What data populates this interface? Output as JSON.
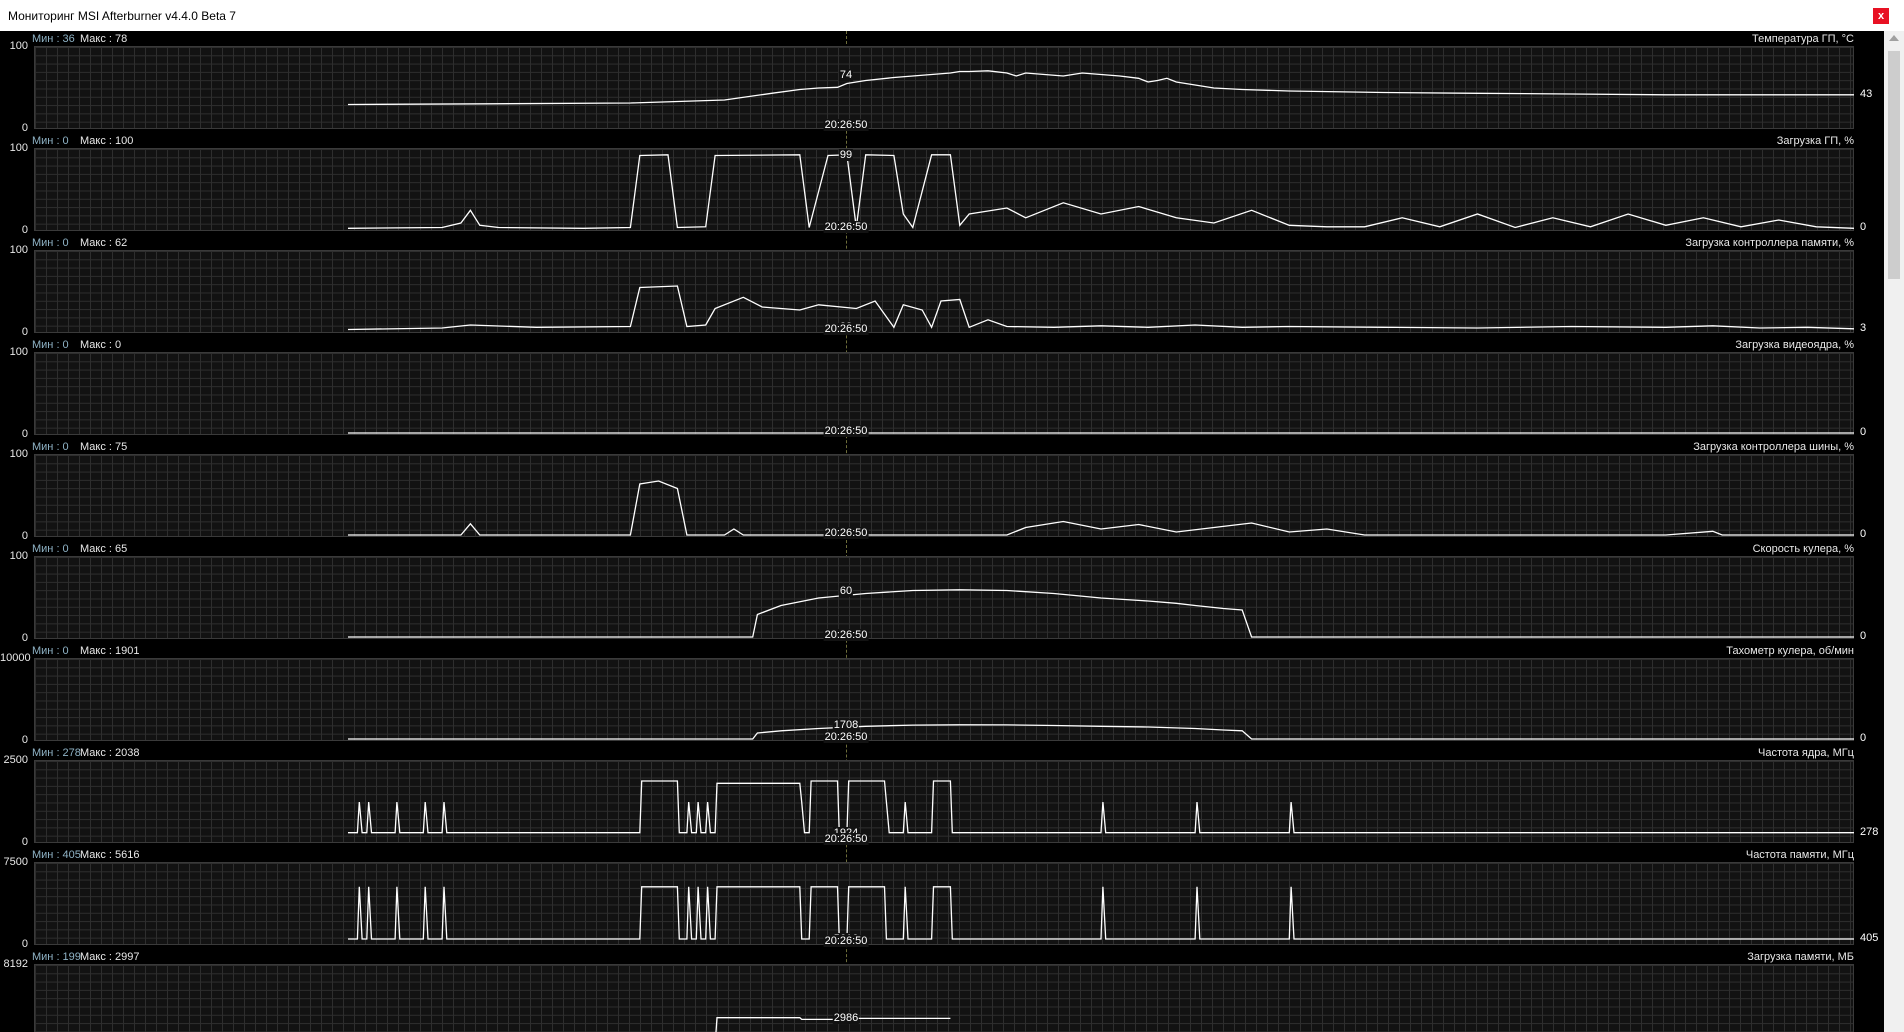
{
  "window": {
    "title": "Мониторинг MSI Afterburner v4.4.0 Beta 7",
    "close_label": "x"
  },
  "cursor_time": "20:26:50",
  "colors": {
    "line": "#ffffff",
    "min_label": "#8fb3c6",
    "grid": "#2e2e2e",
    "background": "#000000",
    "close": "#e81123"
  },
  "graphs": [
    {
      "name": "Температура ГП, °C",
      "min_label": "Мин : 36",
      "max_label": "Макс : 78",
      "axis_max": "100",
      "axis_min": "0",
      "cursor_value": "74",
      "end_value": "43",
      "time_shown": true,
      "ymax": 100,
      "points": [
        [
          0,
          30
        ],
        [
          15,
          31
        ],
        [
          30,
          32
        ],
        [
          40,
          36
        ],
        [
          45,
          45
        ],
        [
          48,
          50
        ],
        [
          50,
          52
        ],
        [
          52,
          53
        ],
        [
          53,
          58
        ],
        [
          55,
          62
        ],
        [
          58,
          66
        ],
        [
          62,
          70
        ],
        [
          64,
          72
        ],
        [
          65,
          74
        ],
        [
          66,
          74
        ],
        [
          68,
          75
        ],
        [
          70,
          72
        ],
        [
          71,
          68
        ],
        [
          72,
          72
        ],
        [
          74,
          70
        ],
        [
          76,
          68
        ],
        [
          78,
          72
        ],
        [
          80,
          70
        ],
        [
          82,
          68
        ],
        [
          84,
          65
        ],
        [
          85,
          60
        ],
        [
          86,
          62
        ],
        [
          87,
          65
        ],
        [
          88,
          60
        ],
        [
          90,
          56
        ],
        [
          92,
          52
        ],
        [
          95,
          50
        ],
        [
          100,
          48
        ],
        [
          110,
          46
        ],
        [
          120,
          45
        ],
        [
          130,
          44
        ],
        [
          140,
          43
        ],
        [
          150,
          43
        ],
        [
          160,
          43
        ]
      ]
    },
    {
      "name": "Загрузка ГП, %",
      "min_label": "Мин : 0",
      "max_label": "Макс : 100",
      "axis_max": "100",
      "axis_min": "0",
      "cursor_value": "99",
      "end_value": "0",
      "time_shown": true,
      "ymax": 100,
      "points": [
        [
          0,
          1
        ],
        [
          10,
          2
        ],
        [
          12,
          8
        ],
        [
          13,
          25
        ],
        [
          14,
          5
        ],
        [
          16,
          2
        ],
        [
          25,
          1
        ],
        [
          30,
          2
        ],
        [
          31,
          98
        ],
        [
          34,
          99
        ],
        [
          35,
          2
        ],
        [
          38,
          3
        ],
        [
          39,
          98
        ],
        [
          48,
          99
        ],
        [
          49,
          2
        ],
        [
          51,
          98
        ],
        [
          53,
          99
        ],
        [
          54,
          2
        ],
        [
          55,
          99
        ],
        [
          58,
          98
        ],
        [
          59,
          20
        ],
        [
          60,
          2
        ],
        [
          62,
          99
        ],
        [
          64,
          99
        ],
        [
          65,
          5
        ],
        [
          66,
          20
        ],
        [
          70,
          28
        ],
        [
          72,
          15
        ],
        [
          76,
          35
        ],
        [
          80,
          20
        ],
        [
          84,
          30
        ],
        [
          88,
          15
        ],
        [
          92,
          8
        ],
        [
          96,
          25
        ],
        [
          100,
          5
        ],
        [
          104,
          3
        ],
        [
          108,
          3
        ],
        [
          112,
          15
        ],
        [
          116,
          3
        ],
        [
          120,
          20
        ],
        [
          124,
          2
        ],
        [
          128,
          15
        ],
        [
          132,
          3
        ],
        [
          136,
          20
        ],
        [
          140,
          5
        ],
        [
          144,
          15
        ],
        [
          148,
          3
        ],
        [
          152,
          12
        ],
        [
          156,
          3
        ],
        [
          160,
          1
        ]
      ]
    },
    {
      "name": "Загрузка контроллера памяти, %",
      "min_label": "Мин : 0",
      "max_label": "Макс : 62",
      "axis_max": "100",
      "axis_min": "0",
      "cursor_value": "23",
      "end_value": "3",
      "time_shown": true,
      "ymax": 100,
      "points": [
        [
          0,
          2
        ],
        [
          10,
          4
        ],
        [
          13,
          8
        ],
        [
          20,
          5
        ],
        [
          30,
          6
        ],
        [
          31,
          58
        ],
        [
          35,
          60
        ],
        [
          36,
          6
        ],
        [
          38,
          8
        ],
        [
          39,
          30
        ],
        [
          42,
          45
        ],
        [
          44,
          32
        ],
        [
          48,
          28
        ],
        [
          50,
          35
        ],
        [
          54,
          30
        ],
        [
          56,
          40
        ],
        [
          58,
          5
        ],
        [
          59,
          35
        ],
        [
          61,
          28
        ],
        [
          62,
          5
        ],
        [
          63,
          40
        ],
        [
          65,
          42
        ],
        [
          66,
          5
        ],
        [
          68,
          15
        ],
        [
          70,
          6
        ],
        [
          75,
          5
        ],
        [
          80,
          7
        ],
        [
          85,
          5
        ],
        [
          90,
          8
        ],
        [
          95,
          5
        ],
        [
          100,
          6
        ],
        [
          110,
          5
        ],
        [
          120,
          4
        ],
        [
          130,
          6
        ],
        [
          140,
          5
        ],
        [
          145,
          7
        ],
        [
          150,
          4
        ],
        [
          155,
          5
        ],
        [
          160,
          3
        ]
      ]
    },
    {
      "name": "Загрузка видеоядра, %",
      "min_label": "Мин : 0",
      "max_label": "Макс : 0",
      "axis_max": "100",
      "axis_min": "0",
      "cursor_value": "",
      "end_value": "0",
      "time_shown": true,
      "ymax": 100,
      "points": [
        [
          0,
          0
        ],
        [
          160,
          0
        ]
      ]
    },
    {
      "name": "Загрузка контроллера шины, %",
      "min_label": "Мин : 0",
      "max_label": "Макс : 75",
      "axis_max": "100",
      "axis_min": "0",
      "cursor_value": "",
      "end_value": "0",
      "time_shown": true,
      "ymax": 100,
      "points": [
        [
          0,
          0
        ],
        [
          12,
          0
        ],
        [
          13,
          15
        ],
        [
          14,
          0
        ],
        [
          30,
          0
        ],
        [
          31,
          68
        ],
        [
          33,
          72
        ],
        [
          35,
          62
        ],
        [
          36,
          0
        ],
        [
          40,
          0
        ],
        [
          41,
          8
        ],
        [
          42,
          0
        ],
        [
          70,
          0
        ],
        [
          72,
          10
        ],
        [
          76,
          18
        ],
        [
          80,
          8
        ],
        [
          84,
          14
        ],
        [
          88,
          4
        ],
        [
          92,
          10
        ],
        [
          96,
          16
        ],
        [
          100,
          4
        ],
        [
          104,
          8
        ],
        [
          108,
          0
        ],
        [
          140,
          0
        ],
        [
          145,
          5
        ],
        [
          146,
          0
        ],
        [
          160,
          0
        ]
      ]
    },
    {
      "name": "Скорость кулера, %",
      "min_label": "Мин : 0",
      "max_label": "Макс : 65",
      "axis_max": "100",
      "axis_min": "0",
      "cursor_value": "60",
      "end_value": "0",
      "time_shown": true,
      "ymax": 100,
      "points": [
        [
          0,
          0
        ],
        [
          43,
          0
        ],
        [
          43.5,
          30
        ],
        [
          46,
          42
        ],
        [
          50,
          52
        ],
        [
          55,
          58
        ],
        [
          60,
          62
        ],
        [
          65,
          63
        ],
        [
          70,
          62
        ],
        [
          75,
          58
        ],
        [
          80,
          52
        ],
        [
          85,
          48
        ],
        [
          88,
          45
        ],
        [
          90,
          42
        ],
        [
          93,
          38
        ],
        [
          95,
          36
        ],
        [
          96,
          0
        ],
        [
          160,
          0
        ]
      ]
    },
    {
      "name": "Тахометр кулера, об/мин",
      "min_label": "Мин : 0",
      "max_label": "Макс : 1901",
      "axis_max": "10000",
      "axis_min": "0",
      "cursor_value": "1708",
      "end_value": "0",
      "time_shown": true,
      "ymax": 10000,
      "points": [
        [
          0,
          0
        ],
        [
          43,
          0
        ],
        [
          43.5,
          800
        ],
        [
          46,
          1100
        ],
        [
          50,
          1400
        ],
        [
          55,
          1700
        ],
        [
          60,
          1850
        ],
        [
          65,
          1900
        ],
        [
          70,
          1880
        ],
        [
          75,
          1800
        ],
        [
          80,
          1700
        ],
        [
          85,
          1600
        ],
        [
          90,
          1400
        ],
        [
          93,
          1200
        ],
        [
          95,
          1100
        ],
        [
          96,
          0
        ],
        [
          160,
          0
        ]
      ]
    },
    {
      "name": "Частота ядра, МГц",
      "min_label": "Мин : 278",
      "max_label": "Макс : 2038",
      "axis_max": "2500",
      "axis_min": "0",
      "cursor_value": "1924",
      "end_value": "278",
      "time_shown": true,
      "ymax": 2500,
      "points": [
        [
          0,
          278
        ],
        [
          1,
          278
        ],
        [
          1.2,
          1300
        ],
        [
          1.5,
          278
        ],
        [
          2,
          278
        ],
        [
          2.2,
          1300
        ],
        [
          2.5,
          278
        ],
        [
          5,
          278
        ],
        [
          5.2,
          1300
        ],
        [
          5.5,
          278
        ],
        [
          8,
          278
        ],
        [
          8.2,
          1300
        ],
        [
          8.5,
          278
        ],
        [
          10,
          278
        ],
        [
          10.2,
          1300
        ],
        [
          10.5,
          278
        ],
        [
          31,
          278
        ],
        [
          31.2,
          2000
        ],
        [
          35,
          2000
        ],
        [
          35.2,
          278
        ],
        [
          36,
          278
        ],
        [
          36.2,
          1300
        ],
        [
          36.5,
          278
        ],
        [
          37,
          278
        ],
        [
          37.2,
          1300
        ],
        [
          37.5,
          278
        ],
        [
          38,
          278
        ],
        [
          38.2,
          1300
        ],
        [
          38.5,
          278
        ],
        [
          39,
          278
        ],
        [
          39.2,
          1924
        ],
        [
          48,
          1924
        ],
        [
          48.2,
          1300
        ],
        [
          48.5,
          278
        ],
        [
          49,
          278
        ],
        [
          49.2,
          2000
        ],
        [
          52,
          2000
        ],
        [
          52.2,
          278
        ],
        [
          53,
          278
        ],
        [
          53.2,
          2000
        ],
        [
          57,
          2000
        ],
        [
          57.2,
          1300
        ],
        [
          57.5,
          278
        ],
        [
          59,
          278
        ],
        [
          59.2,
          1300
        ],
        [
          59.5,
          278
        ],
        [
          62,
          278
        ],
        [
          62.2,
          2000
        ],
        [
          64,
          2000
        ],
        [
          64.2,
          278
        ],
        [
          80,
          278
        ],
        [
          80.2,
          1300
        ],
        [
          80.5,
          278
        ],
        [
          90,
          278
        ],
        [
          90.2,
          1300
        ],
        [
          90.5,
          278
        ],
        [
          100,
          278
        ],
        [
          100.2,
          1300
        ],
        [
          100.5,
          278
        ],
        [
          160,
          278
        ]
      ]
    },
    {
      "name": "Частота памяти, МГц",
      "min_label": "Мин : 405",
      "max_label": "Макс : 5616",
      "axis_max": "7500",
      "axis_min": "0",
      "cursor_value": "5616",
      "end_value": "405",
      "time_shown": true,
      "ymax": 7500,
      "points": [
        [
          0,
          405
        ],
        [
          1,
          405
        ],
        [
          1.2,
          5616
        ],
        [
          1.5,
          405
        ],
        [
          2,
          405
        ],
        [
          2.2,
          5616
        ],
        [
          2.5,
          405
        ],
        [
          5,
          405
        ],
        [
          5.2,
          5616
        ],
        [
          5.5,
          405
        ],
        [
          8,
          405
        ],
        [
          8.2,
          5616
        ],
        [
          8.5,
          405
        ],
        [
          10,
          405
        ],
        [
          10.2,
          5616
        ],
        [
          10.5,
          405
        ],
        [
          31,
          405
        ],
        [
          31.2,
          5616
        ],
        [
          35,
          5616
        ],
        [
          35.2,
          405
        ],
        [
          36,
          405
        ],
        [
          36.2,
          5616
        ],
        [
          36.5,
          405
        ],
        [
          37,
          405
        ],
        [
          37.2,
          5616
        ],
        [
          37.5,
          405
        ],
        [
          38,
          405
        ],
        [
          38.2,
          5616
        ],
        [
          38.5,
          405
        ],
        [
          39,
          405
        ],
        [
          39.2,
          5616
        ],
        [
          48,
          5616
        ],
        [
          48.2,
          405
        ],
        [
          49,
          405
        ],
        [
          49.2,
          5616
        ],
        [
          52,
          5616
        ],
        [
          52.2,
          405
        ],
        [
          53,
          405
        ],
        [
          53.2,
          5616
        ],
        [
          57,
          5616
        ],
        [
          57.2,
          405
        ],
        [
          59,
          405
        ],
        [
          59.2,
          5616
        ],
        [
          59.5,
          405
        ],
        [
          62,
          405
        ],
        [
          62.2,
          5616
        ],
        [
          64,
          5616
        ],
        [
          64.2,
          405
        ],
        [
          80,
          405
        ],
        [
          80.2,
          5616
        ],
        [
          80.5,
          405
        ],
        [
          90,
          405
        ],
        [
          90.2,
          5616
        ],
        [
          90.5,
          405
        ],
        [
          100,
          405
        ],
        [
          100.2,
          5616
        ],
        [
          100.5,
          405
        ],
        [
          160,
          405
        ]
      ]
    },
    {
      "name": "Загрузка памяти, МБ",
      "min_label": "Мин : 199",
      "max_label": "Макс : 2997",
      "axis_max": "8192",
      "axis_min": "",
      "cursor_value": "2986",
      "end_value": "",
      "time_shown": false,
      "ymax": 8192,
      "points": [
        [
          39,
          0
        ],
        [
          39.2,
          2986
        ],
        [
          48,
          2986
        ],
        [
          48.2,
          2800
        ],
        [
          49,
          2800
        ],
        [
          52,
          2800
        ],
        [
          53,
          2900
        ],
        [
          57,
          2900
        ],
        [
          62,
          2900
        ],
        [
          64,
          2900
        ]
      ]
    }
  ]
}
